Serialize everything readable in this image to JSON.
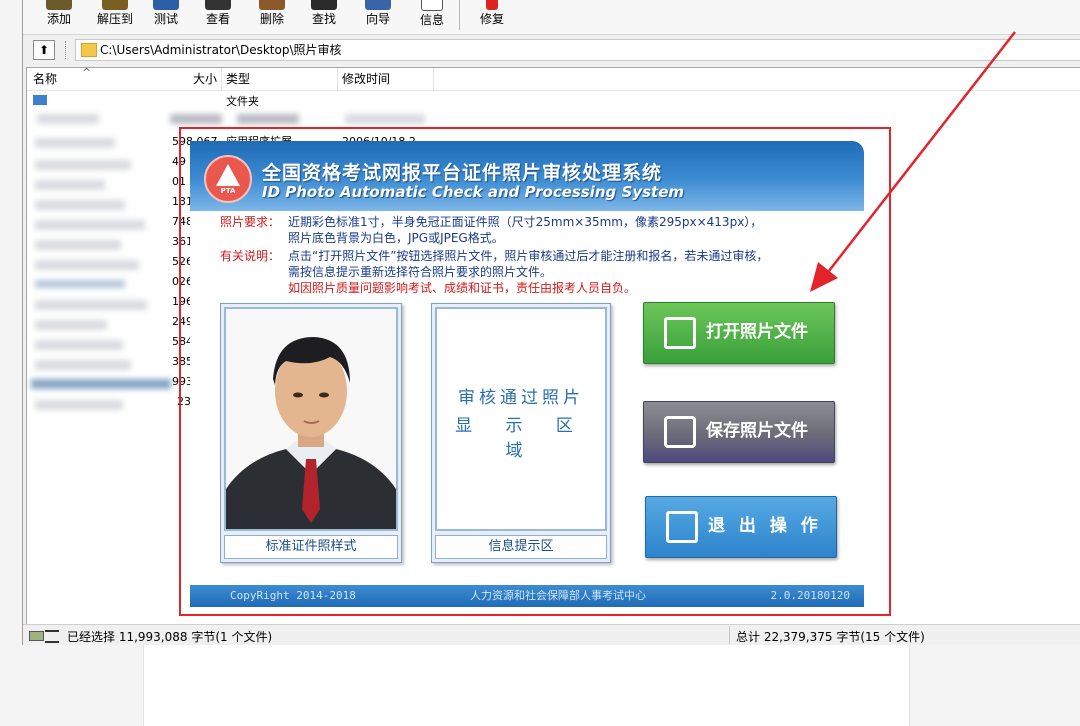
{
  "toolbar": {
    "buttons": [
      {
        "label": "添加",
        "icon": "add-icon"
      },
      {
        "label": "解压到",
        "icon": "extract-icon"
      },
      {
        "label": "测试",
        "icon": "test-icon"
      },
      {
        "label": "查看",
        "icon": "view-icon"
      },
      {
        "label": "删除",
        "icon": "delete-icon"
      },
      {
        "label": "查找",
        "icon": "find-icon"
      },
      {
        "label": "向导",
        "icon": "wizard-icon"
      },
      {
        "label": "信息",
        "icon": "info-icon"
      },
      {
        "label": "修复",
        "icon": "repair-icon"
      }
    ]
  },
  "address": {
    "up_icon": "⬆",
    "path": "C:\\Users\\Administrator\\Desktop\\照片审核"
  },
  "listview": {
    "columns": [
      "名称",
      "大小",
      "类型",
      "修改时间"
    ],
    "parent_row_type": "文件夹",
    "visible_fragments": {
      "size_partial": "598,067",
      "type_partial": "应用程序扩展",
      "date_partial": "2006/10/18 2"
    },
    "size_fragments": [
      "49",
      "01",
      "131",
      "748",
      "361",
      "526",
      "026",
      "196",
      "249",
      "584",
      "385",
      "993",
      "23"
    ]
  },
  "status": {
    "selected": "已经选择 11,993,088 字节(1 个文件)",
    "total": "总计 22,379,375 字节(15 个文件)"
  },
  "app": {
    "title_cn": "全国资格考试网报平台证件照片审核处理系统",
    "title_en": "ID Photo Automatic Check and Processing System",
    "logo_text": "PTA",
    "requirements_label": "照片要求：",
    "requirements_lines": [
      "近期彩色标准1寸，半身免冠正面证件照（尺寸25mm×35mm，像素295px×413px），",
      "照片底色背景为白色，JPG或JPEG格式。"
    ],
    "notes_label": "有关说明：",
    "notes_lines": [
      "点击“打开照片文件”按钮选择照片文件，照片审核通过后才能注册和报名，若未通过审核，",
      "需按信息提示重新选择符合照片要求的照片文件。"
    ],
    "notes_warning": "如因照片质量问题影响考试、成绩和证书，责任由报考人员自负。",
    "sample_caption": "标准证件照样式",
    "approved_zone_line1": "审核通过照片",
    "approved_zone_line2": "显 示 区 域",
    "info_caption": "信息提示区",
    "btn_open": "打开照片文件",
    "btn_save": "保存照片文件",
    "btn_exit": "退 出 操 作",
    "footer_left": "CopyRight 2014-2018",
    "footer_center": "人力资源和社会保障部人事考试中心",
    "footer_right": "2.0.20180120"
  },
  "colors": {
    "annotation_red": "#e3242b",
    "banner_blue": "#2f7dc6",
    "open_green": "#4cb044",
    "exit_blue": "#3b95d6"
  }
}
